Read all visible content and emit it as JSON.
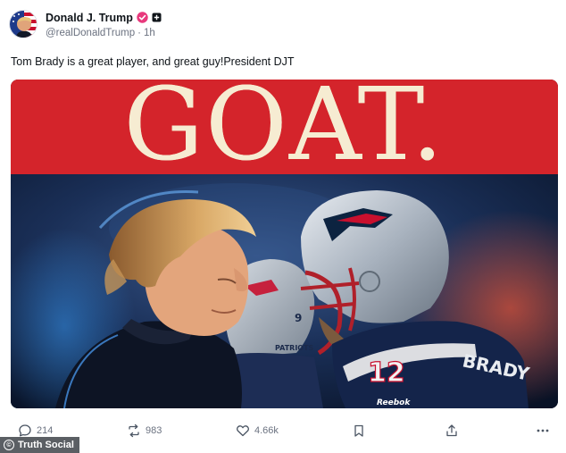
{
  "post": {
    "display_name": "Donald J. Trump",
    "handle": "@realDonaldTrump",
    "time": "1h",
    "text": "Tom Brady is a great player, and great guy!President DJT"
  },
  "image": {
    "banner_text": "GOAT.",
    "helmet_number": "9",
    "helmet_label": "PATRIOTS",
    "jersey_number": "12",
    "jersey_name": "BRADY",
    "brand_mark": "Reebok"
  },
  "actions": {
    "replies": "214",
    "retruths": "983",
    "likes": "4.66k"
  },
  "watermark": {
    "label": "Truth Social"
  },
  "icons": {
    "reply": "comment-bubble-icon",
    "retruth": "repost-arrows-icon",
    "like": "heart-icon",
    "bookmark": "bookmark-icon",
    "share": "share-upload-icon",
    "more": "more-dots-icon",
    "verified": "verified-badge-icon",
    "add": "add-badge-icon"
  },
  "colors": {
    "banner_red": "#d4242b",
    "banner_text": "#f6ecd2",
    "verified_pink": "#e8397c",
    "muted_text": "#6b7280"
  }
}
